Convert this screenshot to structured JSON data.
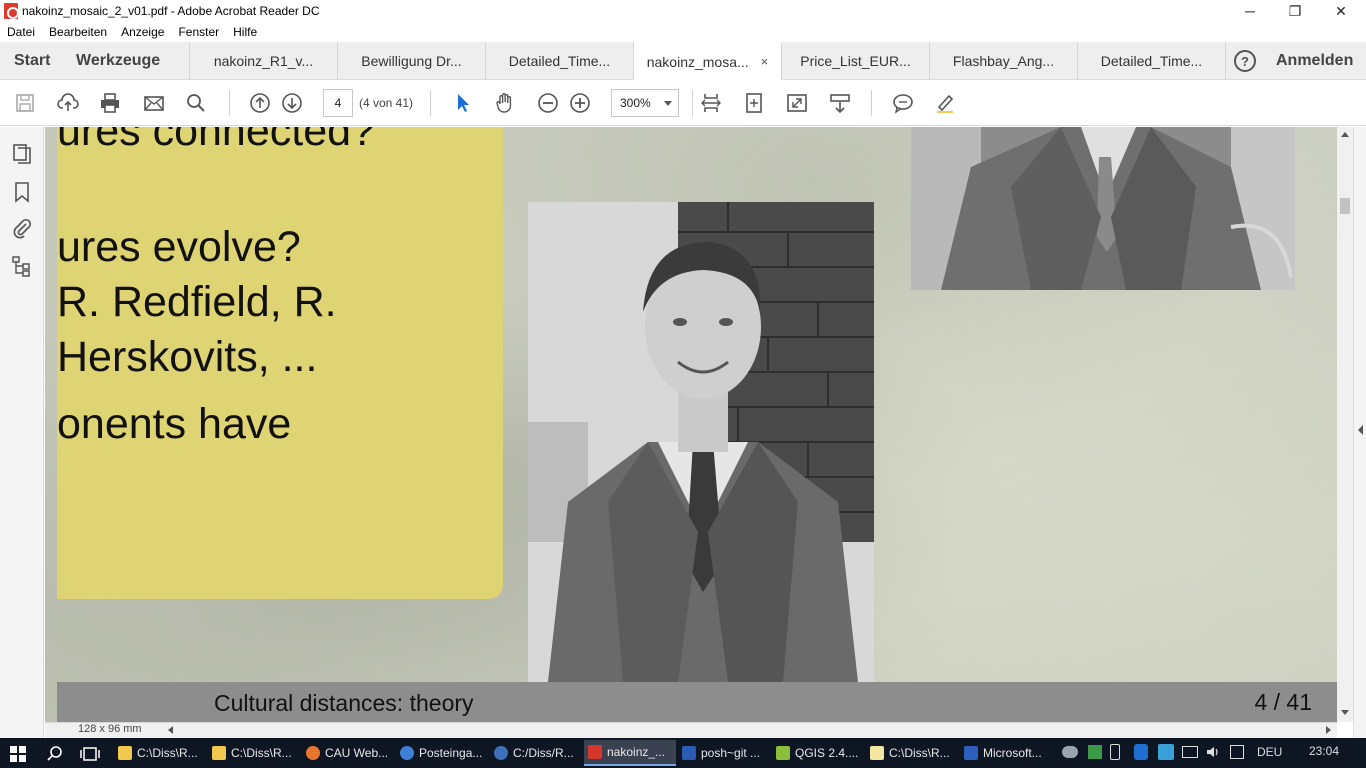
{
  "window": {
    "title": "nakoinz_mosaic_2_v01.pdf - Adobe Acrobat Reader DC",
    "minimize_glyph": "─",
    "maximize_glyph": "❐",
    "close_glyph": "✕"
  },
  "menu": [
    "Datei",
    "Bearbeiten",
    "Anzeige",
    "Fenster",
    "Hilfe"
  ],
  "tabbar": {
    "start": "Start",
    "tools": "Werkzeuge",
    "tabs": [
      {
        "label": "nakoinz_R1_v..."
      },
      {
        "label": "Bewilligung Dr..."
      },
      {
        "label": "Detailed_Time..."
      },
      {
        "label": "nakoinz_mosa...",
        "active": true
      },
      {
        "label": "Price_List_EUR..."
      },
      {
        "label": "Flashbay_Ang..."
      },
      {
        "label": "Detailed_Time..."
      }
    ],
    "close_glyph": "×",
    "help_glyph": "?",
    "signin": "Anmelden"
  },
  "toolbar": {
    "page_value": "4",
    "page_count": "(4 von 41)",
    "zoom_value": "300%"
  },
  "slide": {
    "lines": [
      "ures connected?",
      "ures evolve?",
      " R. Redfield, R.",
      "Herskovits, ...",
      "onents have"
    ],
    "footer_title": "Cultural distances: theory",
    "footer_page": "4 / 41"
  },
  "status": {
    "page_size": "128 x 96 mm"
  },
  "taskbar": {
    "items": [
      {
        "label": "C:\\Diss\\R...",
        "color": "#f2c94c"
      },
      {
        "label": "C:\\Diss\\R...",
        "color": "#f2c94c"
      },
      {
        "label": "CAU Web...",
        "color": "#e8762c"
      },
      {
        "label": "Posteinga...",
        "color": "#3f7fd6"
      },
      {
        "label": "C:/Diss/R...",
        "color": "#3f6fb8"
      },
      {
        "label": "nakoinz_...",
        "color": "#d8352b",
        "active": true
      },
      {
        "label": "posh~git ...",
        "color": "#2a5bb0"
      },
      {
        "label": "QGIS 2.4....",
        "color": "#8bbf3b"
      },
      {
        "label": "C:\\Diss\\R...",
        "color": "#f2e6a0"
      },
      {
        "label": "Microsoft...",
        "color": "#2b5fbb"
      }
    ],
    "language": "DEU",
    "time": "23:04"
  },
  "colors": {
    "slide_box": "#dfd473",
    "footer_bar": "#8d8d8d",
    "taskbar": "#0e1623",
    "select_tool": "#1a6fd6"
  }
}
